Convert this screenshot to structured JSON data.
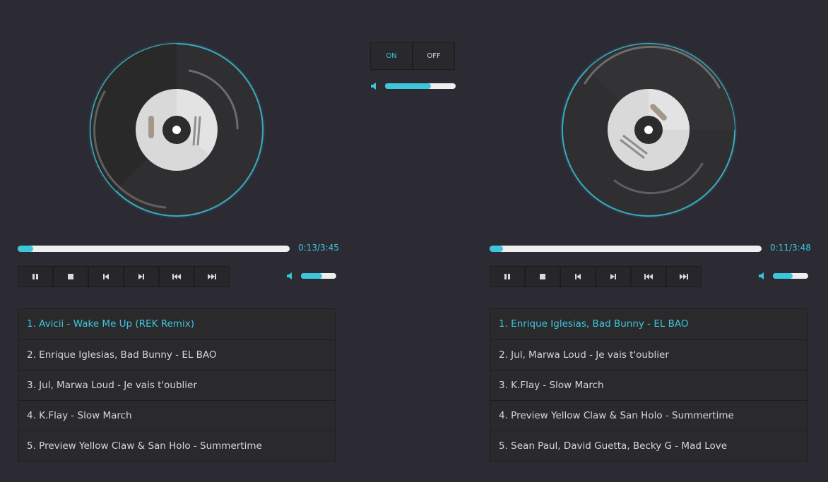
{
  "power": {
    "on_label": "ON",
    "off_label": "OFF",
    "state": "on"
  },
  "master_volume": {
    "level": 0.65
  },
  "accent_color": "#3cc6dc",
  "decks": [
    {
      "time": "0:13/3:45",
      "progress": 0.058,
      "volume": 0.6,
      "controls": [
        "pause-icon",
        "stop-icon",
        "previous-icon",
        "next-icon",
        "rewind-icon",
        "fast-forward-icon"
      ],
      "playlist": [
        {
          "label": "1. Avicii - Wake Me Up (REK Remix)",
          "active": true
        },
        {
          "label": "2. Enrique Iglesias, Bad Bunny - EL BAO",
          "active": false
        },
        {
          "label": "3. Jul, Marwa Loud - Je vais t'oublier",
          "active": false
        },
        {
          "label": "4. K.Flay - Slow March",
          "active": false
        },
        {
          "label": "5. Preview Yellow Claw & San Holo - Summertime",
          "active": false
        }
      ]
    },
    {
      "time": "0:11/3:48",
      "progress": 0.05,
      "volume": 0.55,
      "controls": [
        "pause-icon",
        "stop-icon",
        "previous-icon",
        "next-icon",
        "rewind-icon",
        "fast-forward-icon"
      ],
      "playlist": [
        {
          "label": "1. Enrique Iglesias, Bad Bunny - EL BAO",
          "active": true
        },
        {
          "label": "2. Jul, Marwa Loud - Je vais t'oublier",
          "active": false
        },
        {
          "label": "3. K.Flay - Slow March",
          "active": false
        },
        {
          "label": "4. Preview Yellow Claw & San Holo - Summertime",
          "active": false
        },
        {
          "label": "5. Sean Paul, David Guetta, Becky G - Mad Love",
          "active": false
        }
      ]
    }
  ]
}
